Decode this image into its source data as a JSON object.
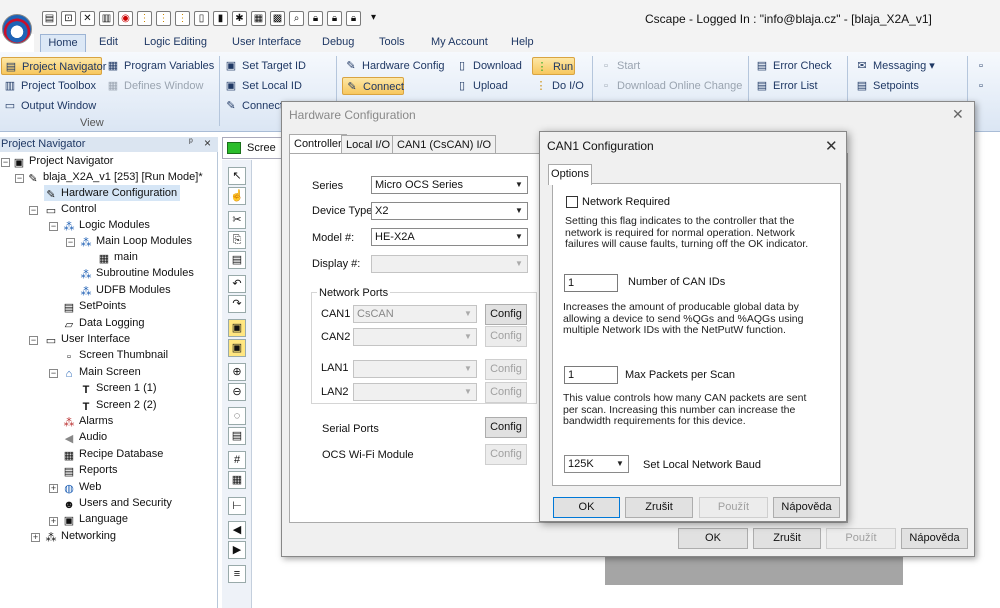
{
  "window": {
    "title": "Cscape - Logged In : \"info@blaja.cz\" - [blaja_X2A_v1]"
  },
  "menu": [
    "Home",
    "Edit",
    "Logic Editing",
    "User Interface",
    "Debug",
    "Tools",
    "My Account",
    "Help"
  ],
  "ribbon": {
    "project_navigator": "Project Navigator",
    "project_toolbox": "Project Toolbox",
    "output_window": "Output Window",
    "program_variables": "Program Variables",
    "defines_window": "Defines Window",
    "view_group": "View",
    "set_target_id": "Set Target  ID",
    "set_local_id": "Set Local  ID",
    "connect_small": "Connect",
    "hardware_config": "Hardware Config",
    "connect": "Connect",
    "download": "Download",
    "upload": "Upload",
    "run": "Run",
    "do_io": "Do I/O",
    "start": "Start",
    "download_online_change": "Download Online Change",
    "error_check": "Error Check",
    "error_list": "Error List",
    "messaging": "Messaging",
    "setpoints": "Setpoints"
  },
  "nav": {
    "header": "Project Navigator",
    "pin": "ᵖ",
    "close": "×",
    "items": [
      "Project Navigator",
      "blaja_X2A_v1 [253] [Run Mode]*",
      "Hardware Configuration",
      "Control",
      "Logic Modules",
      "Main Loop Modules",
      "main",
      "Subroutine Modules",
      "UDFB Modules",
      "SetPoints",
      "Data Logging",
      "User Interface",
      "Screen Thumbnail",
      "Main Screen",
      "Screen 1 (1)",
      "Screen 2 (2)",
      "Alarms",
      "Audio",
      "Recipe Database",
      "Reports",
      "Web",
      "Users and Security",
      "Language",
      "Networking"
    ]
  },
  "screen_tab": "Scree",
  "hw": {
    "title": "Hardware Configuration",
    "tabs": [
      "Controller",
      "Local I/O",
      "CAN1 (CsCAN) I/O"
    ],
    "series_label": "Series",
    "series_value": "Micro OCS Series",
    "device_type_label": "Device Type",
    "device_type_value": "X2",
    "model_label": "Model #:",
    "model_value": "HE-X2A",
    "display_label": "Display #:",
    "network_ports_label": "Network Ports",
    "can1_label": "CAN1",
    "can1_value": "CsCAN",
    "can2_label": "CAN2",
    "lan1_label": "LAN1",
    "lan2_label": "LAN2",
    "config": "Config",
    "serial_ports_label": "Serial Ports",
    "wifi_label": "OCS Wi-Fi Module",
    "ok": "OK",
    "cancel": "Zrušit",
    "apply": "Použít",
    "help": "Nápověda"
  },
  "can": {
    "title": "CAN1 Configuration",
    "tab": "Options",
    "network_required_label": "Network Required",
    "network_required_desc": [
      "Setting this flag indicates to the controller that the",
      "network is required for normal operation.  Network",
      "failures will cause faults, turning off the OK indicator."
    ],
    "num_can_ids_value": "1",
    "num_can_ids_label": "Number of CAN IDs",
    "num_can_ids_desc": [
      "Increases the amount of producable global data by",
      "allowing a device to send %QGs and %AQGs using",
      "multiple Network IDs with the NetPutW function."
    ],
    "max_packets_value": "1",
    "max_packets_label": "Max Packets per Scan",
    "max_packets_desc": [
      "This value controls how many CAN packets are sent",
      "per scan.  Increasing this number can increase the",
      "bandwidth requirements for this device."
    ],
    "baud_value": "125K",
    "baud_label": "Set Local Network Baud",
    "ok": "OK",
    "cancel": "Zrušit",
    "apply": "Použít",
    "help": "Nápověda"
  }
}
